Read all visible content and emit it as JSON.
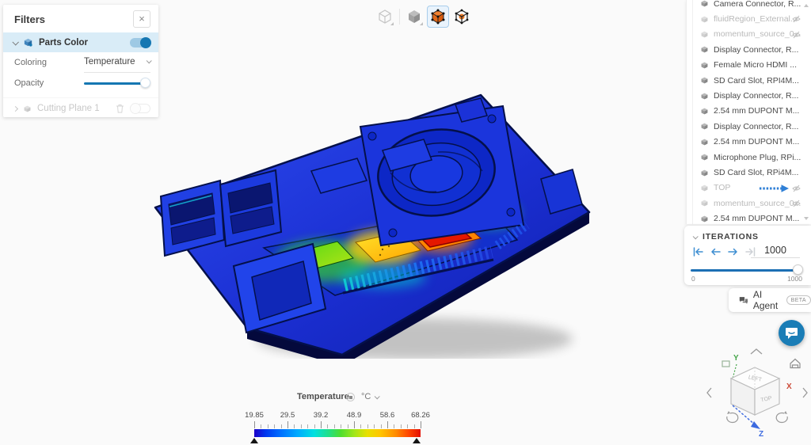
{
  "filters_panel": {
    "title": "Filters",
    "close_glyph": "×",
    "parts_color": {
      "label": "Parts Color",
      "enabled": true
    },
    "coloring": {
      "label": "Coloring",
      "value": "Temperature"
    },
    "opacity": {
      "label": "Opacity",
      "value_pct": 100
    },
    "cutting_plane": {
      "label": "Cutting Plane 1",
      "enabled": false
    }
  },
  "toolbar": {
    "icons": [
      {
        "name": "wireframe-cube-view-icon",
        "selected": false
      },
      {
        "name": "solid-cube-view-icon",
        "selected": false
      },
      {
        "name": "parts-color-cube-icon",
        "selected": true
      },
      {
        "name": "transparent-cube-view-icon",
        "selected": false
      }
    ]
  },
  "parts_panel": {
    "items": [
      {
        "label": "Camera Connector, R...",
        "dimmed": false,
        "eye": false,
        "arrow": false
      },
      {
        "label": "fluidRegion_External...",
        "dimmed": true,
        "eye": true,
        "arrow": false
      },
      {
        "label": "momentum_source_0...",
        "dimmed": true,
        "eye": true,
        "arrow": false
      },
      {
        "label": "Display Connector, R...",
        "dimmed": false,
        "eye": false,
        "arrow": false
      },
      {
        "label": "Female Micro HDMI ...",
        "dimmed": false,
        "eye": false,
        "arrow": false
      },
      {
        "label": "SD Card Slot, RPI4M...",
        "dimmed": false,
        "eye": false,
        "arrow": false
      },
      {
        "label": "Display Connector, R...",
        "dimmed": false,
        "eye": false,
        "arrow": false
      },
      {
        "label": "2.54 mm DUPONT M...",
        "dimmed": false,
        "eye": false,
        "arrow": false
      },
      {
        "label": "Display Connector, R...",
        "dimmed": false,
        "eye": false,
        "arrow": false
      },
      {
        "label": "2.54 mm DUPONT M...",
        "dimmed": false,
        "eye": false,
        "arrow": false
      },
      {
        "label": "Microphone Plug, RPi...",
        "dimmed": false,
        "eye": false,
        "arrow": false
      },
      {
        "label": "SD Card Slot, RPi4M...",
        "dimmed": false,
        "eye": false,
        "arrow": false
      },
      {
        "label": "TOP",
        "dimmed": true,
        "eye": true,
        "arrow": true
      },
      {
        "label": "momentum_source_0...",
        "dimmed": true,
        "eye": true,
        "arrow": false
      },
      {
        "label": "2.54 mm DUPONT M...",
        "dimmed": false,
        "eye": false,
        "arrow": false
      }
    ]
  },
  "iterations": {
    "title": "ITERATIONS",
    "value": "1000",
    "range_min": "0",
    "range_max": "1000"
  },
  "ai_agent": {
    "label": "AI Agent",
    "badge": "BETA"
  },
  "legend": {
    "title": "Temperature",
    "unit": "°C",
    "min": 19.85,
    "max": 68.26,
    "tick_labels": [
      "19.85",
      "29.5",
      "39.2",
      "48.9",
      "58.6",
      "68.26"
    ],
    "tick_percents": [
      0,
      20,
      40,
      60,
      80,
      100
    ]
  },
  "view_cube": {
    "x_label": "X",
    "y_label": "Y",
    "z_label": "Z",
    "top_face": "LEFT",
    "front_face": "TOP"
  },
  "icons": {
    "close": "close-icon",
    "chevron": "chevron-icon",
    "trash": "trash-icon",
    "eye_hidden": "eye-hidden-icon",
    "cube": "cube-icon",
    "home": "home-icon",
    "chat": "chat-bubble-icon",
    "flow_arrow": "flow-arrow-icon"
  },
  "colors": {
    "accent_blue": "#1577b2",
    "selected_row_bg": "#d9ecf7",
    "hot": "#e51700",
    "warm": "#ffd400",
    "cool": "#1c00c8",
    "selected_icon_orange": "#e87722"
  }
}
